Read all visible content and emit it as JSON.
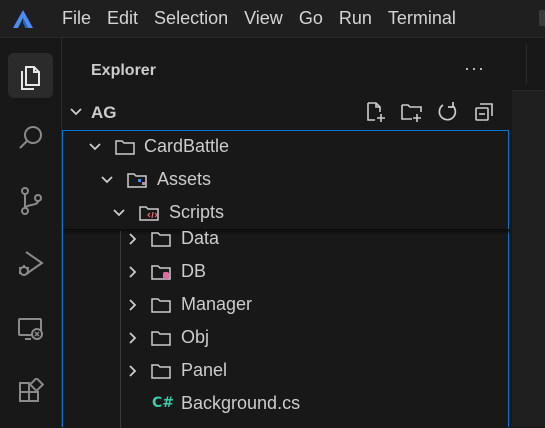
{
  "menu": {
    "items": [
      "File",
      "Edit",
      "Selection",
      "View",
      "Go",
      "Run",
      "Terminal"
    ]
  },
  "activity_bar": {
    "items": [
      {
        "icon": "explorer-icon",
        "active": true
      },
      {
        "icon": "search-icon",
        "active": false
      },
      {
        "icon": "source-control-icon",
        "active": false
      },
      {
        "icon": "run-debug-icon",
        "active": false
      },
      {
        "icon": "remote-explorer-icon",
        "active": false
      },
      {
        "icon": "extensions-icon",
        "active": false
      }
    ]
  },
  "sidebar": {
    "title": "Explorer",
    "more_label": "···",
    "section": {
      "title": "AG",
      "actions": [
        "new-file-icon",
        "new-folder-icon",
        "refresh-icon",
        "collapse-all-icon"
      ]
    },
    "tree": [
      {
        "label": "CardBattle",
        "type": "folder",
        "expanded": true,
        "depth": 0
      },
      {
        "label": "Assets",
        "type": "assets-folder",
        "expanded": true,
        "depth": 1
      },
      {
        "label": "Scripts",
        "type": "scripts-folder",
        "expanded": true,
        "depth": 2
      },
      {
        "label": "Data",
        "type": "folder",
        "expanded": false,
        "depth": 3
      },
      {
        "label": "DB",
        "type": "db-folder",
        "expanded": false,
        "depth": 3
      },
      {
        "label": "Manager",
        "type": "folder",
        "expanded": false,
        "depth": 3
      },
      {
        "label": "Obj",
        "type": "folder",
        "expanded": false,
        "depth": 3
      },
      {
        "label": "Panel",
        "type": "folder",
        "expanded": false,
        "depth": 3
      },
      {
        "label": "Background.cs",
        "type": "csharp-file",
        "depth": 3,
        "file_badge": "C#"
      }
    ]
  },
  "colors": {
    "accent": "#0078d4",
    "logo": "#4d8cf5",
    "csharp": "#3ec9a7",
    "db_badge": "#e06c9f",
    "assets_badge": "#4d8cf5",
    "scripts_badge": "#e06c75"
  }
}
